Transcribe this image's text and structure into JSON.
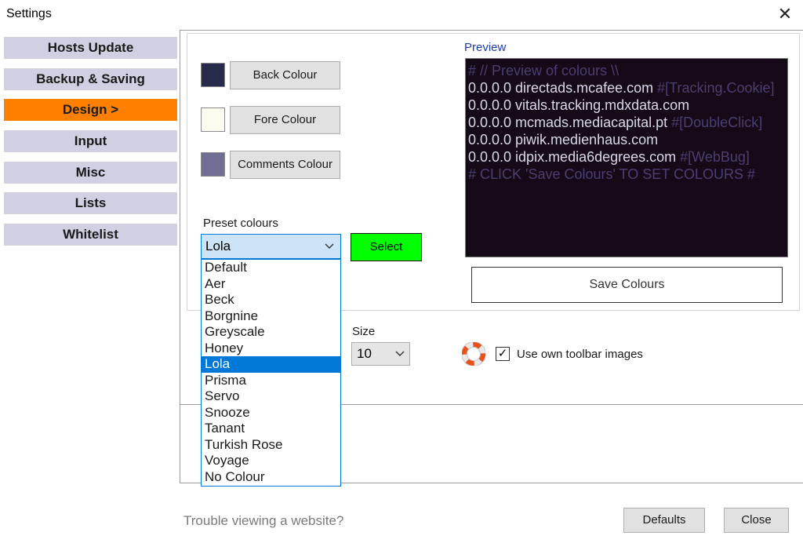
{
  "window": {
    "title": "Settings",
    "close_glyph": "✕"
  },
  "nav": {
    "items": [
      {
        "label": "Hosts Update"
      },
      {
        "label": "Backup & Saving"
      },
      {
        "label": "Design  >",
        "active": true
      },
      {
        "label": "Input"
      },
      {
        "label": "Misc"
      },
      {
        "label": "Lists"
      },
      {
        "label": "Whitelist"
      }
    ]
  },
  "colors": {
    "back_label": "Back Colour",
    "fore_label": "Fore Colour",
    "comments_label": "Comments Colour",
    "back": "#272a4a",
    "fore": "#fbfbf0",
    "comments": "#6f6f96"
  },
  "preset": {
    "label": "Preset colours",
    "selected": "Lola",
    "select_button": "Select",
    "options": [
      "Default",
      "Aer",
      "Beck",
      "Borgnine",
      "Greyscale",
      "Honey",
      "Lola",
      "Prisma",
      "Servo",
      "Snooze",
      "Tanant",
      "Turkish Rose",
      "Voyage",
      "No Colour"
    ]
  },
  "preview": {
    "label": "Preview",
    "lines": [
      {
        "host": "",
        "comment": "# // Preview of colours \\\\"
      },
      {
        "host": "0.0.0.0 directads.mcafee.com",
        "comment": " #[Tracking.Cookie]"
      },
      {
        "host": "0.0.0.0 vitals.tracking.mdxdata.com",
        "comment": ""
      },
      {
        "host": "0.0.0.0 mcmads.mediacapital.pt",
        "comment": " #[DoubleClick]"
      },
      {
        "host": "0.0.0.0 piwik.medienhaus.com",
        "comment": ""
      },
      {
        "host": "0.0.0.0 idpix.media6degrees.com",
        "comment": " #[WebBug]"
      },
      {
        "host": "",
        "comment": "# CLICK 'Save Colours' TO SET COLOURS #"
      }
    ],
    "save_button": "Save Colours"
  },
  "toolbar": {
    "size_label": "Size",
    "size_value": "10",
    "use_own_images_label": "Use own toolbar images",
    "use_own_images_checked": true,
    "check_glyph": "✓"
  },
  "footer": {
    "trouble_text": "Trouble viewing a website?",
    "defaults_button": "Defaults",
    "close_button": "Close"
  }
}
